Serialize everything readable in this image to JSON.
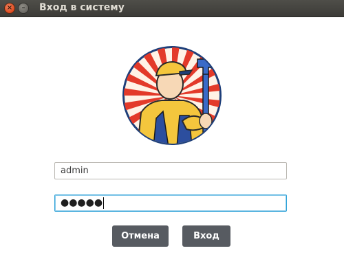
{
  "window": {
    "title": "Вход в систему",
    "close_glyph": "×",
    "minimize_glyph": "–"
  },
  "logo": {
    "icon": "plumber-logo"
  },
  "form": {
    "login_value": "admin",
    "password_dots": "●●●●●"
  },
  "buttons": {
    "cancel_label": "Отмена",
    "login_label": "Вход"
  },
  "colors": {
    "titlebar": "#3c3b37",
    "close": "#df4a1e",
    "button_bg": "#575b61",
    "focus_border": "#2fa2d8"
  }
}
